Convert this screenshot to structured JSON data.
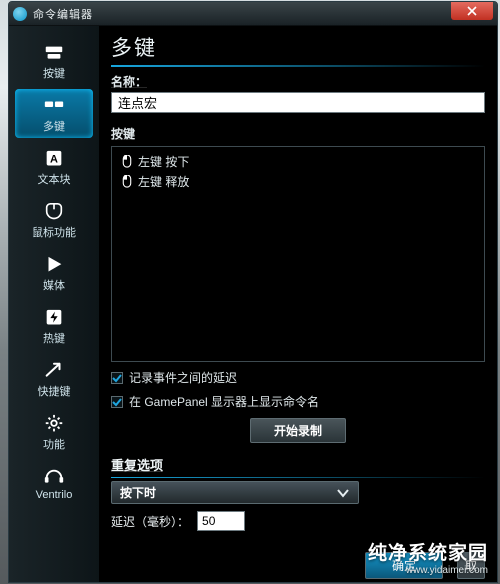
{
  "window": {
    "title": "命令编辑器"
  },
  "sidebar": {
    "items": [
      {
        "label": "按键"
      },
      {
        "label": "多键"
      },
      {
        "label": "文本块"
      },
      {
        "label": "鼠标功能"
      },
      {
        "label": "媒体"
      },
      {
        "label": "热键"
      },
      {
        "label": "快捷键"
      },
      {
        "label": "功能"
      },
      {
        "label": "Ventrilo"
      }
    ]
  },
  "main": {
    "title": "多键",
    "name_label": "名称：",
    "name_value": "连点宏",
    "keys_label": "按键",
    "key_events": [
      "左键 按下",
      "左键 释放"
    ],
    "check_record_delay": "记录事件之间的延迟",
    "check_show_name": "在 GamePanel 显示器上显示命令名",
    "start_record": "开始录制",
    "repeat_title": "重复选项",
    "repeat_mode": "按下时",
    "delay_label": "延迟（毫秒）：",
    "delay_value": "50",
    "ok": "确定",
    "cancel_partial": "取"
  },
  "watermark": {
    "main": "纯净系统家园",
    "sub": "www.yidaimei.com"
  }
}
